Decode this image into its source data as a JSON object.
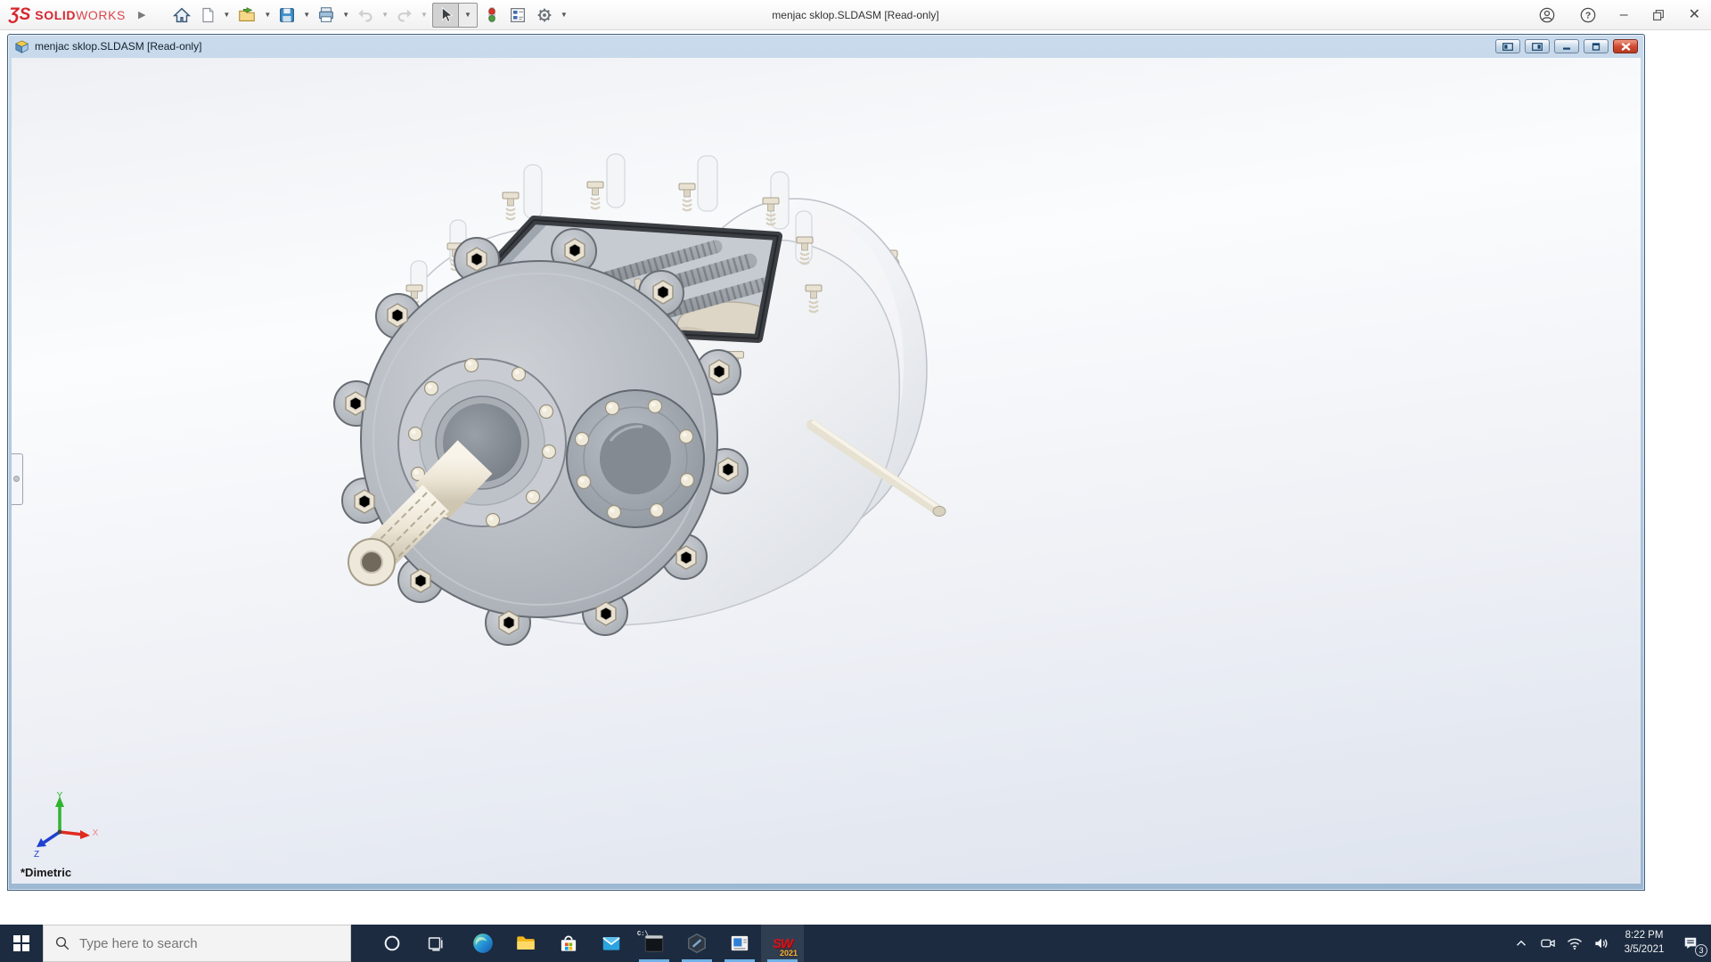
{
  "app": {
    "brand": {
      "mark": "ƷS",
      "bold": "SOLID",
      "light": "WORKS"
    },
    "title": "menjac sklop.SLDASM [Read-only]",
    "toolbar_icons": [
      "flyout-arrow",
      "home",
      "new-document",
      "open",
      "save",
      "print",
      "undo",
      "redo",
      "select-cursor",
      "rebuild-traffic-light",
      "task-pane",
      "options-gear"
    ],
    "titlebar_icons": [
      "account",
      "help",
      "minimize",
      "restore-down",
      "close"
    ]
  },
  "doc": {
    "title": "menjac sklop.SLDASM [Read-only]",
    "window_icons": [
      "assembly-document",
      "tile-left",
      "tile-right",
      "minimize",
      "restore",
      "close"
    ],
    "view_name": "*Dimetric",
    "axis_labels": {
      "x": "X",
      "y": "Y",
      "z": "Z"
    },
    "model_description": "Shaded 3D view of a gearbox assembly (menjac sklop): gray front plate with hex bolts, two bolted circular flanges, splined input shaft, thin output shaft, open top cover with gasket, springs-loaded bolts and internal gear shafts"
  },
  "taskbar": {
    "search_placeholder": "Type here to search",
    "app_icons": [
      "edge",
      "file-explorer",
      "microsoft-store",
      "mail",
      "command-prompt",
      "hexagon-app",
      "media-window",
      "solidworks-2021"
    ],
    "running_indicator_apps": [
      "command-prompt",
      "hexagon-app",
      "media-window",
      "solidworks-2021"
    ],
    "cmd_glyph": "C:\\_",
    "sw_glyph": "SW",
    "sw_year": "2021",
    "tray_icons": [
      "hidden-icons-chevron",
      "meet-now",
      "wifi",
      "volume",
      "action-center"
    ],
    "clock": {
      "time": "8:22 PM",
      "date": "3/5/2021"
    },
    "notification_count": "3"
  },
  "colors": {
    "taskbar_bg": "#1c2b40",
    "brand_red": "#d6272e",
    "doc_titlebar_top": "#c9daec",
    "doc_titlebar_bottom": "#9cb8d3",
    "close_button": "#cf4a32",
    "viewport_bottom": "#dde3ee",
    "running_indicator": "#6fb3e8",
    "triad_x": "#e02b20",
    "triad_y": "#2eb52e",
    "triad_z": "#2040d0"
  }
}
